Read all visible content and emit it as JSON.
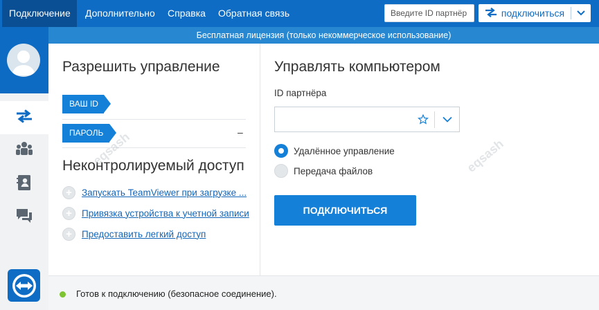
{
  "menu": {
    "items": [
      {
        "label": "Подключение",
        "active": true
      },
      {
        "label": "Дополнительно",
        "active": false
      },
      {
        "label": "Справка",
        "active": false
      },
      {
        "label": "Обратная связь",
        "active": false
      }
    ]
  },
  "header": {
    "partner_id_placeholder": "Введите ID партнёр",
    "connect_label": "подключиться"
  },
  "license_banner": "Бесплатная лицензия (только некоммерческое использование)",
  "sidebar": {
    "items": [
      {
        "icon": "arrows-swap-icon",
        "active": true
      },
      {
        "icon": "meeting-people-icon",
        "active": false
      },
      {
        "icon": "contacts-book-icon",
        "active": false
      },
      {
        "icon": "chat-bubbles-icon",
        "active": false
      }
    ],
    "logo_icon": "teamviewer-logo-icon"
  },
  "allow_control": {
    "title": "Разрешить управление",
    "your_id_label": "ВАШ ID",
    "your_id_value": "",
    "password_label": "ПАРОЛЬ",
    "password_value": "–"
  },
  "unattended": {
    "title": "Неконтролируемый доступ",
    "links": [
      "Запускать TeamViewer при загрузке ...",
      "Привязка устройства к учетной записи",
      "Предоставить легкий доступ"
    ]
  },
  "control_remote": {
    "title": "Управлять компьютером",
    "partner_id_label": "ID партнёра",
    "partner_id_value": "",
    "options": [
      {
        "label": "Удалённое управление",
        "selected": true
      },
      {
        "label": "Передача файлов",
        "selected": false
      }
    ],
    "connect_button": "ПОДКЛЮЧИТЬСЯ"
  },
  "status": {
    "text": "Готов к подключению (безопасное соединение).",
    "color": "#7ec432"
  },
  "watermark": "eqsash",
  "colors": {
    "brand": "#0e6cc4",
    "accent": "#1480d8"
  }
}
